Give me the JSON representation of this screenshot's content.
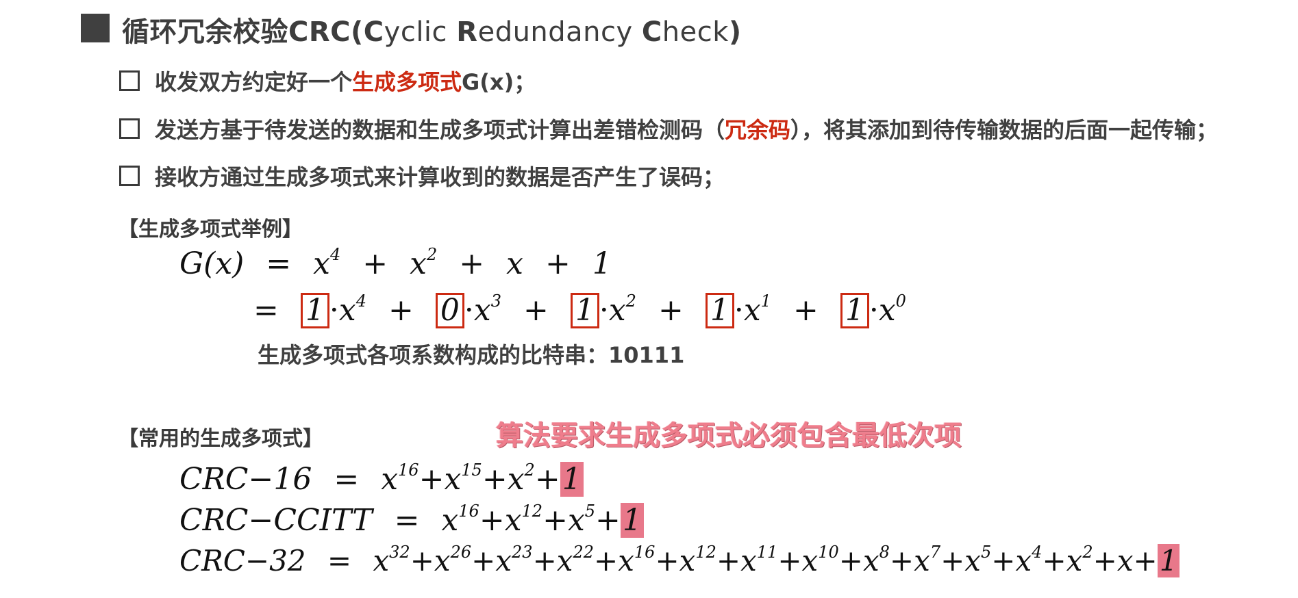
{
  "title": {
    "prefix": "循环冗余校验CRC(",
    "c1": "C",
    "w1": "yclic ",
    "c2": "R",
    "w2": "edundancy ",
    "c3": "C",
    "w3": "heck",
    "suffix": ")"
  },
  "bullets": [
    {
      "pre": "收发双方约定好一个",
      "red": "生成多项式",
      "post": "G(x)；"
    },
    {
      "pre": "发送方基于待发送的数据和生成多项式计算出差错检测码（",
      "red": "冗余码",
      "post": "），将其添加到待传输数据的后面一起传输；"
    },
    {
      "pre": "接收方通过生成多项式来计算收到的数据是否产生了误码；",
      "red": "",
      "post": ""
    }
  ],
  "example": {
    "heading": "【生成多项式举例】",
    "line1": {
      "lhs": "G(x)",
      "eq": "=",
      "t1b": "x",
      "t1e": "4",
      "plus": "+",
      "t2b": "x",
      "t2e": "2",
      "t3": "x",
      "t4": "1"
    },
    "line2": {
      "eq": "=",
      "terms": [
        {
          "coef": "1",
          "exp": "4"
        },
        {
          "coef": "0",
          "exp": "3"
        },
        {
          "coef": "1",
          "exp": "2"
        },
        {
          "coef": "1",
          "exp": "1"
        },
        {
          "coef": "1",
          "exp": "0"
        }
      ],
      "dot": "·",
      "x": "x",
      "plus": "+"
    },
    "bitstring": "生成多项式各项系数构成的比特串：10111"
  },
  "common": {
    "heading": "【常用的生成多项式】",
    "note": "算法要求生成多项式必须包含最低次项",
    "rows": [
      {
        "name": "CRC−16",
        "eq": "=",
        "exps": [
          "16",
          "15",
          "2"
        ],
        "last": "1"
      },
      {
        "name": "CRC−CCITT",
        "eq": "=",
        "exps": [
          "16",
          "12",
          "5"
        ],
        "last": "1"
      },
      {
        "name": "CRC−32",
        "eq": "=",
        "exps": [
          "32",
          "26",
          "23",
          "22",
          "16",
          "12",
          "11",
          "10",
          "8",
          "7",
          "5",
          "4",
          "2"
        ],
        "tail": "x",
        "last": "1"
      }
    ]
  },
  "colors": {
    "accent_red": "#cc2a12",
    "highlight_pink": "#e8788a",
    "note_pink": "#ef7d8c",
    "text_dark": "#3a3a3a"
  }
}
